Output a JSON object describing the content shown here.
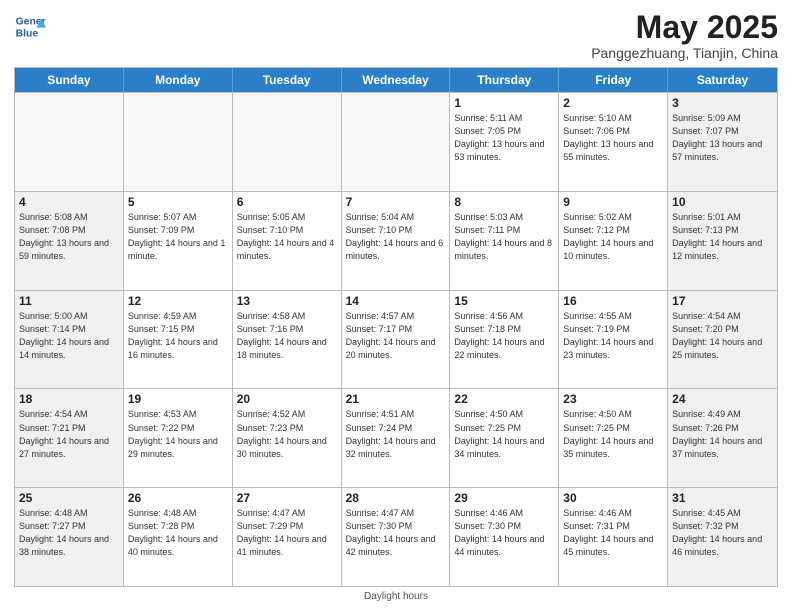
{
  "header": {
    "logo_line1": "General",
    "logo_line2": "Blue",
    "month_title": "May 2025",
    "subtitle": "Panggezhuang, Tianjin, China"
  },
  "day_headers": [
    "Sunday",
    "Monday",
    "Tuesday",
    "Wednesday",
    "Thursday",
    "Friday",
    "Saturday"
  ],
  "weeks": [
    [
      {
        "day": "",
        "info": ""
      },
      {
        "day": "",
        "info": ""
      },
      {
        "day": "",
        "info": ""
      },
      {
        "day": "",
        "info": ""
      },
      {
        "day": "1",
        "info": "Sunrise: 5:11 AM\nSunset: 7:05 PM\nDaylight: 13 hours\nand 53 minutes."
      },
      {
        "day": "2",
        "info": "Sunrise: 5:10 AM\nSunset: 7:06 PM\nDaylight: 13 hours\nand 55 minutes."
      },
      {
        "day": "3",
        "info": "Sunrise: 5:09 AM\nSunset: 7:07 PM\nDaylight: 13 hours\nand 57 minutes."
      }
    ],
    [
      {
        "day": "4",
        "info": "Sunrise: 5:08 AM\nSunset: 7:08 PM\nDaylight: 13 hours\nand 59 minutes."
      },
      {
        "day": "5",
        "info": "Sunrise: 5:07 AM\nSunset: 7:09 PM\nDaylight: 14 hours\nand 1 minute."
      },
      {
        "day": "6",
        "info": "Sunrise: 5:05 AM\nSunset: 7:10 PM\nDaylight: 14 hours\nand 4 minutes."
      },
      {
        "day": "7",
        "info": "Sunrise: 5:04 AM\nSunset: 7:10 PM\nDaylight: 14 hours\nand 6 minutes."
      },
      {
        "day": "8",
        "info": "Sunrise: 5:03 AM\nSunset: 7:11 PM\nDaylight: 14 hours\nand 8 minutes."
      },
      {
        "day": "9",
        "info": "Sunrise: 5:02 AM\nSunset: 7:12 PM\nDaylight: 14 hours\nand 10 minutes."
      },
      {
        "day": "10",
        "info": "Sunrise: 5:01 AM\nSunset: 7:13 PM\nDaylight: 14 hours\nand 12 minutes."
      }
    ],
    [
      {
        "day": "11",
        "info": "Sunrise: 5:00 AM\nSunset: 7:14 PM\nDaylight: 14 hours\nand 14 minutes."
      },
      {
        "day": "12",
        "info": "Sunrise: 4:59 AM\nSunset: 7:15 PM\nDaylight: 14 hours\nand 16 minutes."
      },
      {
        "day": "13",
        "info": "Sunrise: 4:58 AM\nSunset: 7:16 PM\nDaylight: 14 hours\nand 18 minutes."
      },
      {
        "day": "14",
        "info": "Sunrise: 4:57 AM\nSunset: 7:17 PM\nDaylight: 14 hours\nand 20 minutes."
      },
      {
        "day": "15",
        "info": "Sunrise: 4:56 AM\nSunset: 7:18 PM\nDaylight: 14 hours\nand 22 minutes."
      },
      {
        "day": "16",
        "info": "Sunrise: 4:55 AM\nSunset: 7:19 PM\nDaylight: 14 hours\nand 23 minutes."
      },
      {
        "day": "17",
        "info": "Sunrise: 4:54 AM\nSunset: 7:20 PM\nDaylight: 14 hours\nand 25 minutes."
      }
    ],
    [
      {
        "day": "18",
        "info": "Sunrise: 4:54 AM\nSunset: 7:21 PM\nDaylight: 14 hours\nand 27 minutes."
      },
      {
        "day": "19",
        "info": "Sunrise: 4:53 AM\nSunset: 7:22 PM\nDaylight: 14 hours\nand 29 minutes."
      },
      {
        "day": "20",
        "info": "Sunrise: 4:52 AM\nSunset: 7:23 PM\nDaylight: 14 hours\nand 30 minutes."
      },
      {
        "day": "21",
        "info": "Sunrise: 4:51 AM\nSunset: 7:24 PM\nDaylight: 14 hours\nand 32 minutes."
      },
      {
        "day": "22",
        "info": "Sunrise: 4:50 AM\nSunset: 7:25 PM\nDaylight: 14 hours\nand 34 minutes."
      },
      {
        "day": "23",
        "info": "Sunrise: 4:50 AM\nSunset: 7:25 PM\nDaylight: 14 hours\nand 35 minutes."
      },
      {
        "day": "24",
        "info": "Sunrise: 4:49 AM\nSunset: 7:26 PM\nDaylight: 14 hours\nand 37 minutes."
      }
    ],
    [
      {
        "day": "25",
        "info": "Sunrise: 4:48 AM\nSunset: 7:27 PM\nDaylight: 14 hours\nand 38 minutes."
      },
      {
        "day": "26",
        "info": "Sunrise: 4:48 AM\nSunset: 7:28 PM\nDaylight: 14 hours\nand 40 minutes."
      },
      {
        "day": "27",
        "info": "Sunrise: 4:47 AM\nSunset: 7:29 PM\nDaylight: 14 hours\nand 41 minutes."
      },
      {
        "day": "28",
        "info": "Sunrise: 4:47 AM\nSunset: 7:30 PM\nDaylight: 14 hours\nand 42 minutes."
      },
      {
        "day": "29",
        "info": "Sunrise: 4:46 AM\nSunset: 7:30 PM\nDaylight: 14 hours\nand 44 minutes."
      },
      {
        "day": "30",
        "info": "Sunrise: 4:46 AM\nSunset: 7:31 PM\nDaylight: 14 hours\nand 45 minutes."
      },
      {
        "day": "31",
        "info": "Sunrise: 4:45 AM\nSunset: 7:32 PM\nDaylight: 14 hours\nand 46 minutes."
      }
    ]
  ],
  "footer": {
    "note": "Daylight hours"
  },
  "colors": {
    "header_bg": "#2a7fc7",
    "accent": "#2a5ba8"
  }
}
